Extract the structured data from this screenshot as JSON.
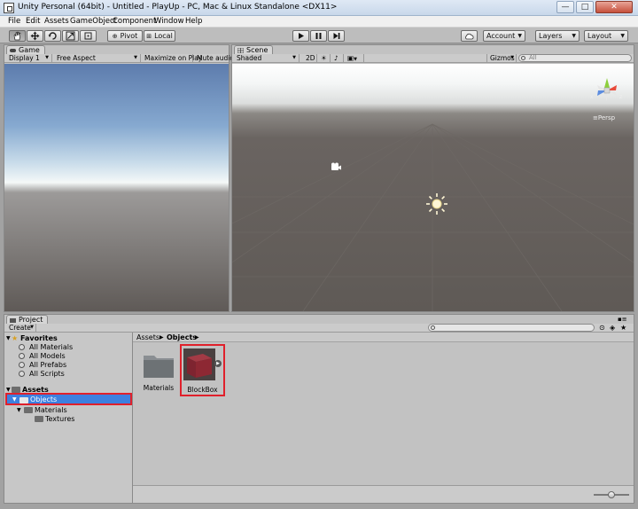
{
  "window": {
    "title": "Unity Personal (64bit) - Untitled - PlayUp - PC, Mac & Linux Standalone <DX11>",
    "controls": {
      "minimize": "—",
      "maximize": "□",
      "close": "✕"
    }
  },
  "menu": [
    "File",
    "Edit",
    "Assets",
    "GameObject",
    "Component",
    "Window",
    "Help"
  ],
  "toolbar": {
    "transform_tools": [
      "hand-icon",
      "move-icon",
      "rotate-icon",
      "scale-icon",
      "rect-icon"
    ],
    "pivot_label": "Pivot",
    "local_label": "Local",
    "play_controls": [
      "play-icon",
      "pause-icon",
      "step-icon"
    ],
    "account_label": "Account",
    "layers_label": "Layers",
    "layout_label": "Layout"
  },
  "game": {
    "tab_label": "Game",
    "display_label": "Display 1",
    "aspect_label": "Free Aspect",
    "maximize_label": "Maximize on Play",
    "mute_label": "Mute audio"
  },
  "scene": {
    "tab_label": "Scene",
    "shading_label": "Shaded",
    "mode_2d_label": "2D",
    "gizmos_label": "Gizmos",
    "search_placeholder": "All",
    "persp_label": "Persp",
    "axis_x": "x",
    "axis_z": "z"
  },
  "project": {
    "tab_label": "Project",
    "create_label": "Create",
    "favorites_label": "Favorites",
    "favorites": [
      "All Materials",
      "All Models",
      "All Prefabs",
      "All Scripts"
    ],
    "assets_label": "Assets",
    "tree": [
      {
        "label": "Objects",
        "level": 1,
        "selected": true
      },
      {
        "label": "Materials",
        "level": 2,
        "selected": false
      },
      {
        "label": "Textures",
        "level": 3,
        "selected": false
      }
    ],
    "breadcrumb": {
      "root": "Assets",
      "current": "Objects"
    },
    "items": [
      {
        "label": "Materials",
        "kind": "folder"
      },
      {
        "label": "BlockBox",
        "kind": "prefab"
      }
    ]
  },
  "colors": {
    "highlight": "#e0202b",
    "selection": "#3d80df",
    "sky_top": "#5d7cad",
    "ground": "#5f5a57",
    "cube": "#8d2833"
  }
}
